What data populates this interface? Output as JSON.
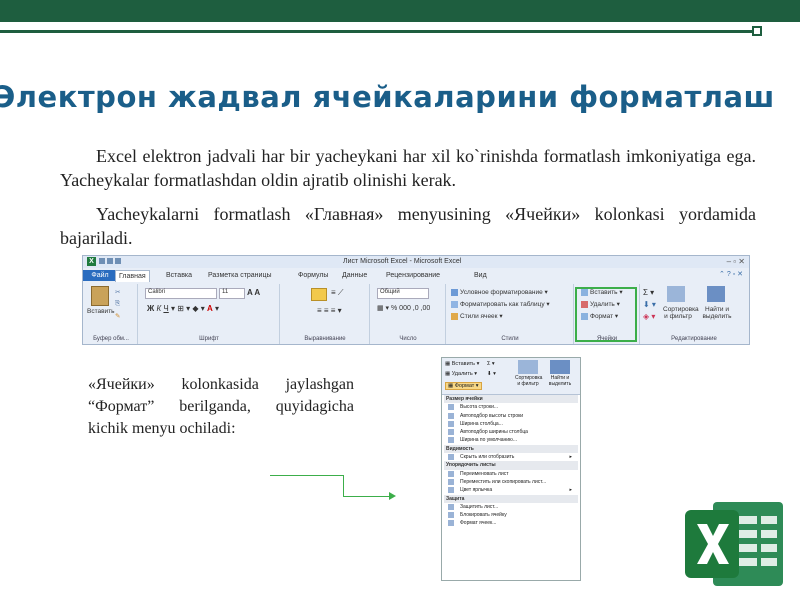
{
  "slide": {
    "title": "Электрон жадвал ячейкаларини форматлаш",
    "paragraph1": "Excel elektron jadvali har bir yacheykani har xil ko`rinishda formatlash imkoniyatiga ega. Yacheykalar formatlashdan oldin ajratib olinishi kerak.",
    "paragraph2": "Yacheykalarni formatlash «Главная» menyusining «Ячейки» kolonkasi yordamida bajariladi.",
    "side_text": "«Ячейки» kolonkasida jaylashgan “Формат” berilganda, quyidagicha kichik menyu ochiladi:",
    "colors": {
      "accent": "#1e5e3f",
      "title": "#1a5e89",
      "highlight": "#3cae4a"
    }
  },
  "ribbon": {
    "window_title": "Лист Microsoft Excel  -  Microsoft Excel",
    "tabs": [
      "Файл",
      "Главная",
      "Вставка",
      "Разметка страницы",
      "Формулы",
      "Данные",
      "Рецензирование",
      "Вид"
    ],
    "font_name": "Calibri",
    "font_size": "11",
    "number_format": "Общий",
    "paste_label": "Вставить",
    "buttons": {
      "conditional": "Условное форматирование",
      "as_table": "Форматировать как таблицу",
      "cell_styles": "Стили ячеек",
      "insert": "Вставить",
      "delete": "Удалить",
      "format": "Формат",
      "sort": "Сортировка и фильтр",
      "find": "Найти и выделить"
    },
    "groups": [
      "Буфер обм...",
      "Шрифт",
      "Выравнивание",
      "Число",
      "Стили",
      "Ячейки",
      "Редактирование"
    ]
  },
  "menu": {
    "top_buttons": [
      "Вставить",
      "Удалить",
      "Формат"
    ],
    "top_big": [
      "Сортировка и фильтр",
      "Найти и выделить"
    ],
    "items": [
      {
        "text": "Размер ячейки",
        "head": true
      },
      {
        "text": "Высота строки..."
      },
      {
        "text": "Автоподбор высоты строки"
      },
      {
        "text": "Ширина столбца..."
      },
      {
        "text": "Автоподбор ширины столбца"
      },
      {
        "text": "Ширина по умолчанию..."
      },
      {
        "text": "Видимость",
        "head": true
      },
      {
        "text": "Скрыть или отобразить",
        "sub": true
      },
      {
        "text": "Упорядочить листы",
        "head": true
      },
      {
        "text": "Переименовать лист"
      },
      {
        "text": "Переместить или скопировать лист..."
      },
      {
        "text": "Цвет ярлычка",
        "sub": true
      },
      {
        "text": "Защита",
        "head": true
      },
      {
        "text": "Защитить лист..."
      },
      {
        "text": "Блокировать ячейку"
      },
      {
        "text": "Формат ячеек..."
      }
    ]
  }
}
